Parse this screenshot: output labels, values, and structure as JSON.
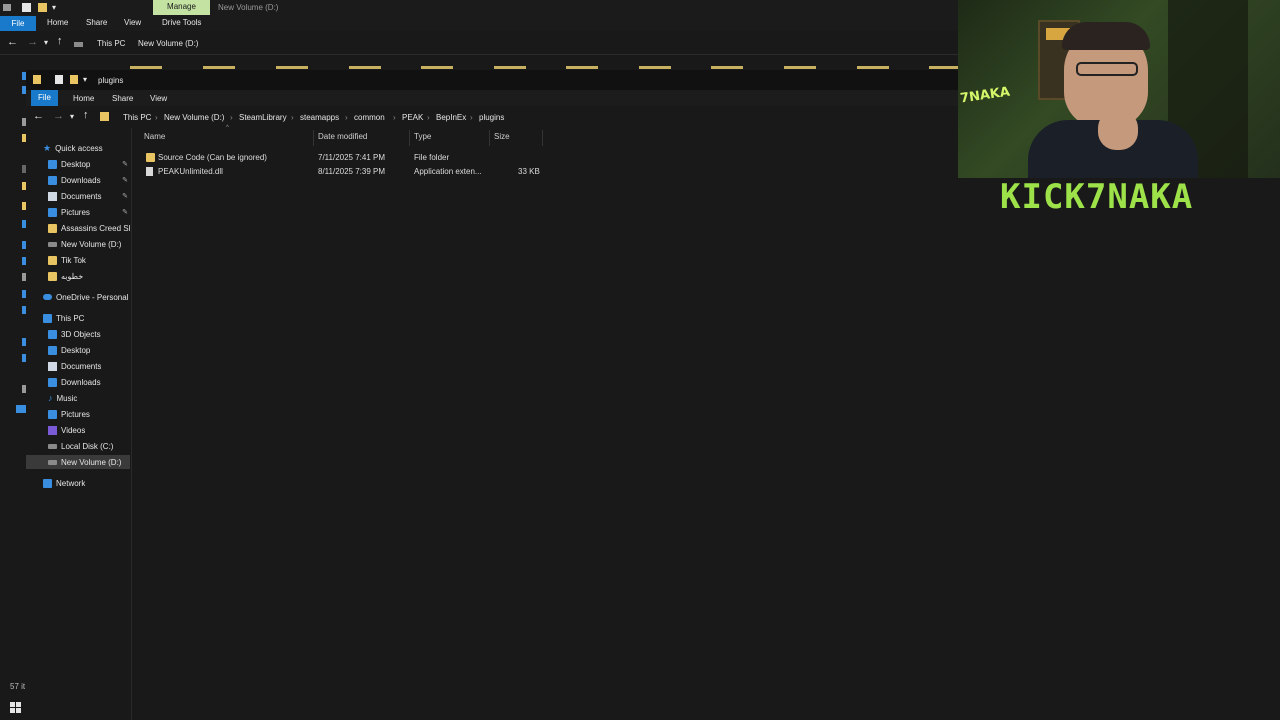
{
  "back_window": {
    "title": "New Volume (D:)",
    "manage_tab": "Manage",
    "ribbon_tabs": [
      "File",
      "Home",
      "Share",
      "View",
      "Drive Tools"
    ],
    "breadcrumb": [
      "This PC",
      "New Volume (D:)"
    ],
    "status_count": "57 it"
  },
  "front_window": {
    "title": "plugins",
    "ribbon_tabs": [
      "File",
      "Home",
      "Share",
      "View"
    ],
    "breadcrumb": [
      "This PC",
      "New Volume (D:)",
      "SteamLibrary",
      "steamapps",
      "common",
      "PEAK",
      "BepInEx",
      "plugins"
    ],
    "columns": [
      "Name",
      "Date modified",
      "Type",
      "Size"
    ],
    "files": [
      {
        "name": "Source Code (Can be ignored)",
        "date": "7/11/2025 7:41 PM",
        "type": "File folder",
        "size": "",
        "icon": "folder-icon"
      },
      {
        "name": "PEAKUnlimited.dll",
        "date": "8/11/2025 7:39 PM",
        "type": "Application exten...",
        "size": "33 KB",
        "icon": "file-icon"
      }
    ]
  },
  "nav": {
    "quick_access": "Quick access",
    "quick_items": [
      "Desktop",
      "Downloads",
      "Documents",
      "Pictures",
      "Assassins Creed Sha",
      "New Volume (D:)",
      "Tik Tok",
      "خطوبه"
    ],
    "onedrive": "OneDrive - Personal",
    "this_pc": "This PC",
    "pc_items": [
      "3D Objects",
      "Desktop",
      "Documents",
      "Downloads",
      "Music",
      "Pictures",
      "Videos",
      "Local Disk (C:)",
      "New Volume (D:)"
    ],
    "network": "Network"
  },
  "overlay": {
    "logo_text": "KICK7NAKA",
    "neon_text": "7NAKA"
  },
  "colors": {
    "accent": "#1979ca",
    "manage": "#c4e2a2",
    "folder": "#e9c463",
    "logo": "#9ee24a"
  }
}
